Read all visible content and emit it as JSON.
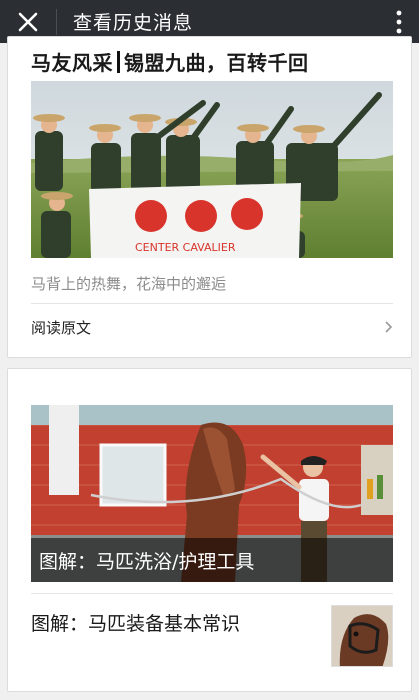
{
  "topbar": {
    "title": "查看历史消息",
    "close_icon": "close-icon",
    "more_icon": "more-vertical-icon"
  },
  "article1": {
    "headline_left": "马友风采",
    "headline_right": "锡盟九曲，百转千回",
    "summary": "马背上的热舞，花海中的邂逅",
    "read_more": "阅读原文",
    "banner_text": "CENTER CAVALIER"
  },
  "article2": {
    "main_caption": "图解：马匹洗浴/护理工具",
    "sub_title": "图解：马匹装备基本常识"
  },
  "colors": {
    "topbar": "#2b2f33",
    "card_bg": "#ffffff",
    "page_bg": "#f0f0f0",
    "accent_red": "#d8342b"
  }
}
